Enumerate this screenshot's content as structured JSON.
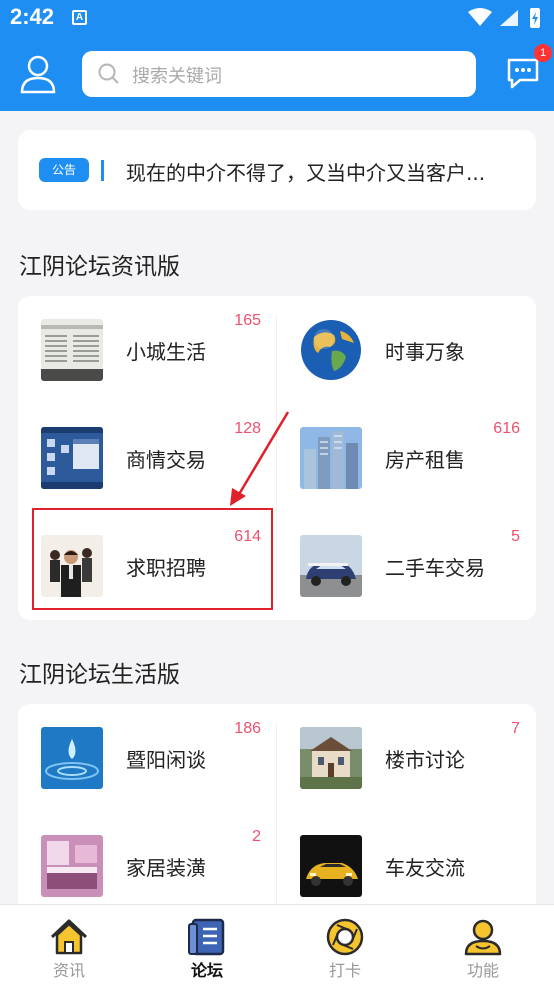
{
  "status": {
    "time": "2:42",
    "a_icon": "A"
  },
  "header": {
    "search_placeholder": "搜索关键词",
    "message_badge": "1"
  },
  "notice": {
    "tag": "公告",
    "text": "现在的中介不得了，又当中介又当客户..."
  },
  "sections": [
    {
      "title": "江阴论坛资讯版",
      "items": [
        {
          "label": "小城生活",
          "count": "165",
          "icon": "newspaper-thumb"
        },
        {
          "label": "时事万象",
          "count": "",
          "icon": "globe-thumb"
        },
        {
          "label": "商情交易",
          "count": "128",
          "icon": "desktop-thumb"
        },
        {
          "label": "房产租售",
          "count": "616",
          "icon": "buildings-thumb"
        },
        {
          "label": "求职招聘",
          "count": "614",
          "icon": "people-thumb"
        },
        {
          "label": "二手车交易",
          "count": "5",
          "icon": "car-thumb"
        }
      ]
    },
    {
      "title": "江阴论坛生活版",
      "items": [
        {
          "label": "暨阳闲谈",
          "count": "186",
          "icon": "water-drop-thumb"
        },
        {
          "label": "楼市讨论",
          "count": "7",
          "icon": "mansion-thumb"
        },
        {
          "label": "家居装潢",
          "count": "2",
          "icon": "bedroom-thumb"
        },
        {
          "label": "车友交流",
          "count": "",
          "icon": "sportscar-thumb"
        }
      ]
    }
  ],
  "tabs": [
    {
      "label": "资讯",
      "icon": "home-icon",
      "active": false
    },
    {
      "label": "论坛",
      "icon": "book-icon",
      "active": true
    },
    {
      "label": "打卡",
      "icon": "camera-aperture-icon",
      "active": false
    },
    {
      "label": "功能",
      "icon": "user-icon",
      "active": false
    }
  ],
  "colors": {
    "brand": "#1e8ef2",
    "count": "#f0506e",
    "highlight": "#e0202a",
    "tab_icon": "#f6c42e"
  }
}
